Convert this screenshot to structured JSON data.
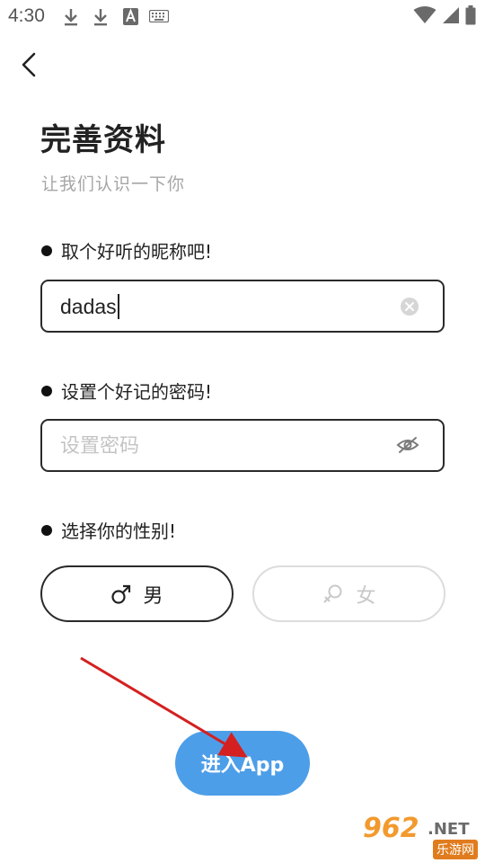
{
  "status_bar": {
    "time": "4:30",
    "icons": [
      "download-icon",
      "download-icon",
      "text-a-icon",
      "keyboard-icon",
      "wifi-icon",
      "signal-icon",
      "battery-icon"
    ]
  },
  "header": {
    "title": "完善资料",
    "subtitle": "让我们认识一下你"
  },
  "nickname": {
    "label": "取个好听的昵称吧!",
    "value": "dadas"
  },
  "password": {
    "label": "设置个好记的密码!",
    "placeholder": "设置密码"
  },
  "gender": {
    "label": "选择你的性别!",
    "options": [
      {
        "label": "男",
        "selected": true
      },
      {
        "label": "女",
        "selected": false
      }
    ]
  },
  "enter_button": {
    "label": "进入App",
    "color": "#4d9ee8"
  },
  "watermark": {
    "number": "962",
    "domain": ".NET",
    "sub": "乐游网"
  },
  "colors": {
    "annotation_arrow": "#d42020",
    "accent": "#4d9ee8"
  }
}
